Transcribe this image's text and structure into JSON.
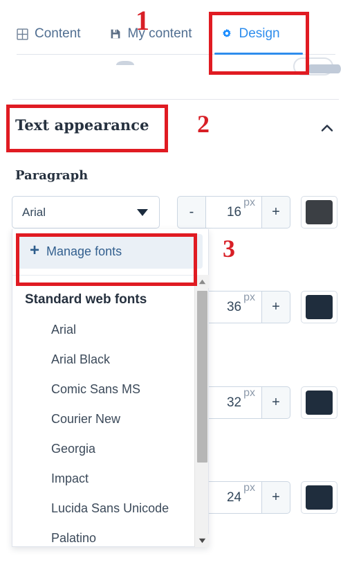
{
  "tabs": [
    {
      "label": "Content",
      "icon": "grid-icon",
      "active": false
    },
    {
      "label": "My content",
      "icon": "save-icon",
      "active": false
    },
    {
      "label": "Design",
      "icon": "gear-icon",
      "active": true
    }
  ],
  "section": {
    "title": "Text appearance",
    "collapse_icon": "chevron-up-icon"
  },
  "rows": [
    {
      "label": "Paragraph",
      "font": "Arial",
      "size": "16",
      "unit": "px",
      "minus": "-",
      "plus": "+",
      "color": "#3b3f44"
    },
    {
      "size": "36",
      "unit": "px",
      "plus": "+",
      "color": "#1f2d3d"
    },
    {
      "size": "32",
      "unit": "px",
      "plus": "+",
      "color": "#1f2d3d"
    },
    {
      "size": "24",
      "unit": "px",
      "plus": "+",
      "color": "#1f2d3d"
    }
  ],
  "dropdown": {
    "manage_fonts": "Manage fonts",
    "manage_fonts_icon": "plus-icon",
    "group_header": "Standard web fonts",
    "options": [
      "Arial",
      "Arial Black",
      "Comic Sans MS",
      "Courier New",
      "Georgia",
      "Impact",
      "Lucida Sans Unicode",
      "Palatino"
    ],
    "scroll_up_icon": "scroll-up-arrow-icon",
    "scroll_down_icon": "scroll-down-arrow-icon"
  },
  "annotations": [
    {
      "number": "1"
    },
    {
      "number": "2"
    },
    {
      "number": "3"
    }
  ],
  "colors": {
    "accent": "#2e8ded",
    "annotation": "#d81f26",
    "text": "#33475b"
  }
}
